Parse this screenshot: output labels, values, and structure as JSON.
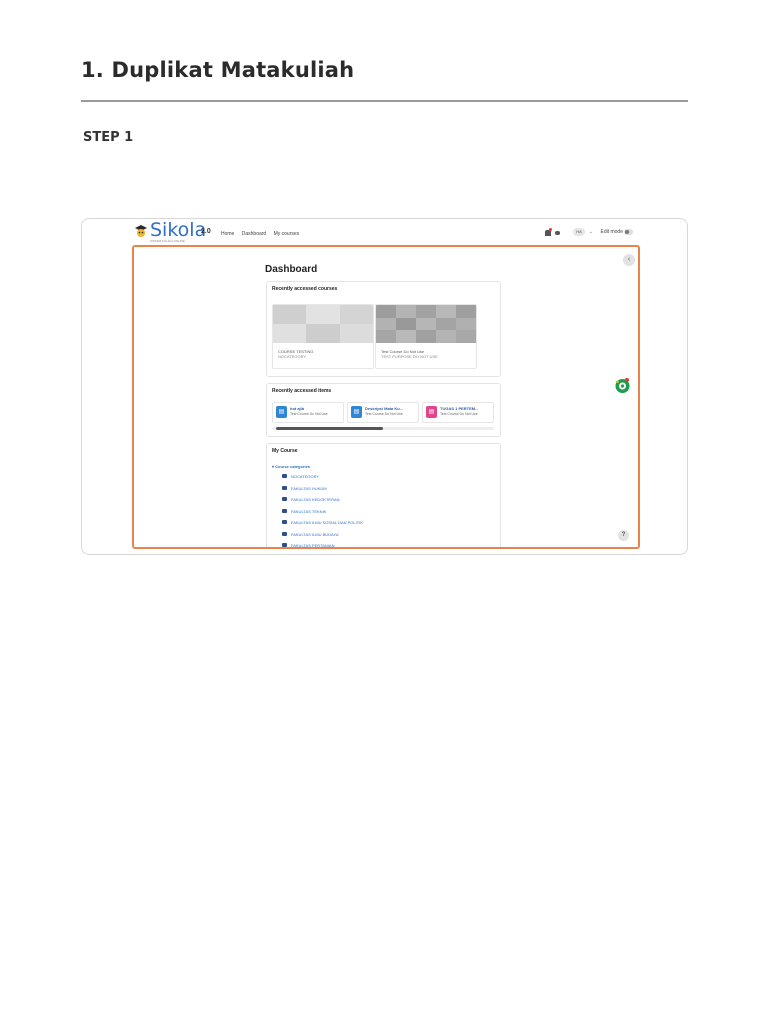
{
  "document": {
    "title": "1. Duplikat Matakuliah",
    "step_label": "STEP 1"
  },
  "screenshot": {
    "brand": {
      "name": "Sikola",
      "version": "2.0",
      "tagline": "SISTEM KULIAH ONLINE"
    },
    "nav": [
      "Home",
      "Dashboard",
      "My courses"
    ],
    "user_menu": {
      "avatar_initials": "HA",
      "edit_mode_label": "Edit mode"
    },
    "page_title": "Dashboard",
    "recent_courses": {
      "heading": "Recently accessed courses",
      "courses": [
        {
          "name": "COURSE TESTING",
          "category": "NOCATEGORY"
        },
        {
          "name": "Test Course Do Not Use",
          "category": "TEST PURPOSE DO NOT USE"
        }
      ]
    },
    "recent_items": {
      "heading": "Recently accessed items",
      "items": [
        {
          "title": "hot ajib",
          "course": "Test Course Do Not Use",
          "color": "#2f86d6"
        },
        {
          "title": "Deskripsi Mata Ku...",
          "course": "Test Course Do Not Use",
          "color": "#2f86d6"
        },
        {
          "title": "TUGAS 1 PERTEM...",
          "course": "Test Course Do Not Use",
          "color": "#e0448a"
        }
      ]
    },
    "my_course": {
      "heading": "My Course",
      "tree_root": "Course categories",
      "categories": [
        "NOCATEGORY",
        "FAKULTAS HUKUM",
        "FAKULTAS KEDOKTERAN",
        "FAKULTAS TEKNIK",
        "FAKULTAS ILMU SOSIAL DAN POLITIK",
        "FAKULTAS ILMU BUDAYA",
        "FAKULTAS PERTANIAN"
      ]
    },
    "colors": {
      "highlight_frame": "#e8834a",
      "link": "#2f6fc9"
    }
  }
}
